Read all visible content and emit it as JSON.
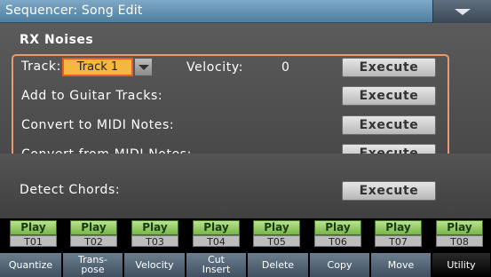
{
  "window": {
    "title": "Sequencer: Song Edit",
    "menu_icon": "chevron-down-icon"
  },
  "section": {
    "title": "RX Noises"
  },
  "rx": {
    "track_label": "Track:",
    "track_value": "Track 1",
    "velocity_label": "Velocity:",
    "velocity_value": "0",
    "add_guitar_label": "Add to Guitar Tracks:",
    "convert_to_label": "Convert to MIDI Notes:",
    "convert_from_label": "Convert from MIDI Notes:",
    "execute_label": "Execute"
  },
  "detect": {
    "label": "Detect Chords:",
    "execute_label": "Execute"
  },
  "tracks": [
    {
      "play": "Play",
      "num": "T01"
    },
    {
      "play": "Play",
      "num": "T02"
    },
    {
      "play": "Play",
      "num": "T03"
    },
    {
      "play": "Play",
      "num": "T04"
    },
    {
      "play": "Play",
      "num": "T05"
    },
    {
      "play": "Play",
      "num": "T06"
    },
    {
      "play": "Play",
      "num": "T07"
    },
    {
      "play": "Play",
      "num": "T08"
    }
  ],
  "tabs": [
    {
      "label": "Quantize"
    },
    {
      "label": "Trans-\npose"
    },
    {
      "label": "Velocity"
    },
    {
      "label": "Cut\nInsert"
    },
    {
      "label": "Delete"
    },
    {
      "label": "Copy"
    },
    {
      "label": "Move"
    },
    {
      "label": "Utility",
      "active": true
    }
  ],
  "colors": {
    "accent_border": "#e89a72",
    "play_green": "#79b548",
    "track_select": "#f5b642"
  }
}
